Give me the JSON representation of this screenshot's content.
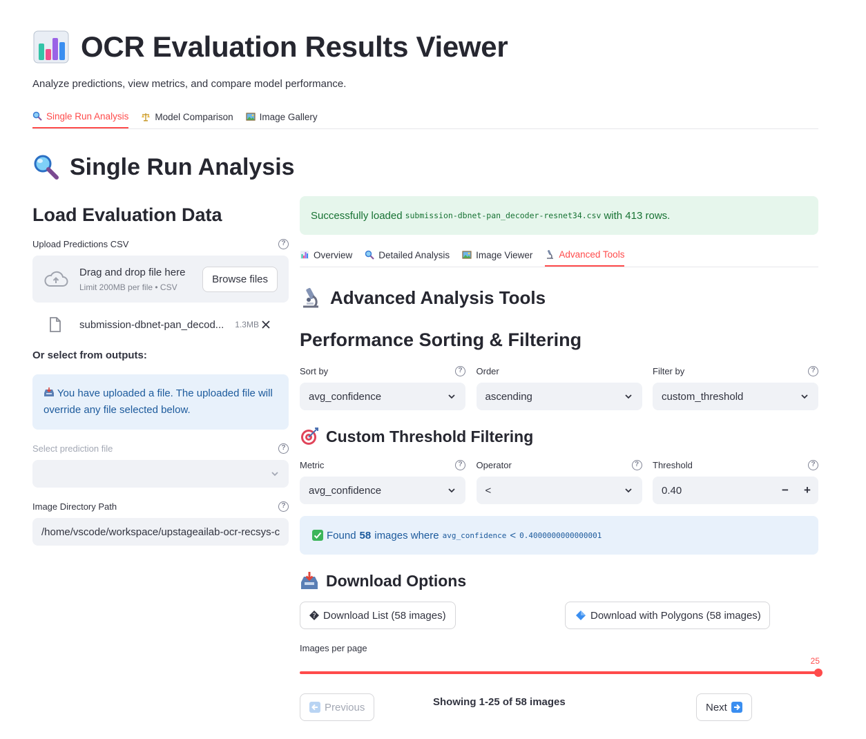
{
  "app": {
    "title": "OCR Evaluation Results Viewer",
    "subtitle": "Analyze predictions, view metrics, and compare model performance."
  },
  "main_tabs": [
    {
      "label": "Single Run Analysis",
      "icon": "magnifier-icon",
      "active": true
    },
    {
      "label": "Model Comparison",
      "icon": "scales-icon",
      "active": false
    },
    {
      "label": "Image Gallery",
      "icon": "picture-icon",
      "active": false
    }
  ],
  "section": {
    "title": "Single Run Analysis"
  },
  "left": {
    "heading": "Load Evaluation Data",
    "upload_label": "Upload Predictions CSV",
    "drag_text": "Drag and drop file here",
    "limit_text": "Limit 200MB per file • CSV",
    "browse_label": "Browse files",
    "file_name": "submission-dbnet-pan_decod...",
    "file_size": "1.3MB",
    "or_select": "Or select from outputs:",
    "info_text": "You have uploaded a file. The uploaded file will override any file selected below.",
    "select_label": "Select prediction file",
    "select_value": "",
    "imgdir_label": "Image Directory Path",
    "imgdir_value": "/home/vscode/workspace/upstageailab-ocr-recsys-c"
  },
  "right": {
    "success_prefix": "Successfully loaded",
    "success_file": "submission-dbnet-pan_decoder-resnet34.csv",
    "success_suffix": "with 413 rows.",
    "sub_tabs": [
      {
        "label": "Overview",
        "icon": "bar-chart-icon",
        "active": false
      },
      {
        "label": "Detailed Analysis",
        "icon": "magnifier-icon",
        "active": false
      },
      {
        "label": "Image Viewer",
        "icon": "picture-icon",
        "active": false
      },
      {
        "label": "Advanced Tools",
        "icon": "microscope-icon",
        "active": true
      }
    ],
    "advanced_title": "Advanced Analysis Tools",
    "sort_heading": "Performance Sorting & Filtering",
    "sort_by_label": "Sort by",
    "sort_by_value": "avg_confidence",
    "order_label": "Order",
    "order_value": "ascending",
    "filter_label": "Filter by",
    "filter_value": "custom_threshold",
    "threshold_heading": "Custom Threshold Filtering",
    "metric_label": "Metric",
    "metric_value": "avg_confidence",
    "operator_label": "Operator",
    "operator_value": "<",
    "threshold_label": "Threshold",
    "threshold_value": "0.40",
    "found_prefix": "Found",
    "found_count": "58",
    "found_mid": "images where",
    "found_metric": "avg_confidence",
    "found_op": "<",
    "found_value": "0.4000000000000001",
    "download_heading": "Download Options",
    "download_list_label": "Download List (58 images)",
    "download_polygons_label": "Download with Polygons (58 images)",
    "per_page_label": "Images per page",
    "per_page_value": "25",
    "previous_label": "Previous",
    "showing_text": "Showing 1-25 of 58 images",
    "next_label": "Next"
  },
  "colors": {
    "accent": "#ff4b4b",
    "success_bg": "#e6f6ec",
    "success_text": "#177233",
    "info_bg": "#e8f1fb",
    "info_text": "#1c5a9c"
  }
}
